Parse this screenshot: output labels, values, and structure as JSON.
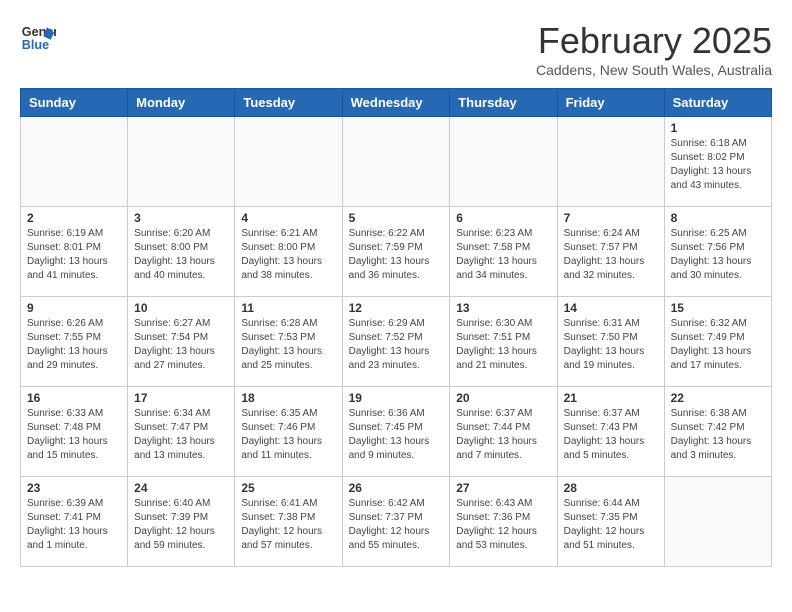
{
  "logo": {
    "line1": "General",
    "line2": "Blue"
  },
  "title": "February 2025",
  "location": "Caddens, New South Wales, Australia",
  "weekdays": [
    "Sunday",
    "Monday",
    "Tuesday",
    "Wednesday",
    "Thursday",
    "Friday",
    "Saturday"
  ],
  "weeks": [
    [
      {
        "day": "",
        "info": ""
      },
      {
        "day": "",
        "info": ""
      },
      {
        "day": "",
        "info": ""
      },
      {
        "day": "",
        "info": ""
      },
      {
        "day": "",
        "info": ""
      },
      {
        "day": "",
        "info": ""
      },
      {
        "day": "1",
        "info": "Sunrise: 6:18 AM\nSunset: 8:02 PM\nDaylight: 13 hours\nand 43 minutes."
      }
    ],
    [
      {
        "day": "2",
        "info": "Sunrise: 6:19 AM\nSunset: 8:01 PM\nDaylight: 13 hours\nand 41 minutes."
      },
      {
        "day": "3",
        "info": "Sunrise: 6:20 AM\nSunset: 8:00 PM\nDaylight: 13 hours\nand 40 minutes."
      },
      {
        "day": "4",
        "info": "Sunrise: 6:21 AM\nSunset: 8:00 PM\nDaylight: 13 hours\nand 38 minutes."
      },
      {
        "day": "5",
        "info": "Sunrise: 6:22 AM\nSunset: 7:59 PM\nDaylight: 13 hours\nand 36 minutes."
      },
      {
        "day": "6",
        "info": "Sunrise: 6:23 AM\nSunset: 7:58 PM\nDaylight: 13 hours\nand 34 minutes."
      },
      {
        "day": "7",
        "info": "Sunrise: 6:24 AM\nSunset: 7:57 PM\nDaylight: 13 hours\nand 32 minutes."
      },
      {
        "day": "8",
        "info": "Sunrise: 6:25 AM\nSunset: 7:56 PM\nDaylight: 13 hours\nand 30 minutes."
      }
    ],
    [
      {
        "day": "9",
        "info": "Sunrise: 6:26 AM\nSunset: 7:55 PM\nDaylight: 13 hours\nand 29 minutes."
      },
      {
        "day": "10",
        "info": "Sunrise: 6:27 AM\nSunset: 7:54 PM\nDaylight: 13 hours\nand 27 minutes."
      },
      {
        "day": "11",
        "info": "Sunrise: 6:28 AM\nSunset: 7:53 PM\nDaylight: 13 hours\nand 25 minutes."
      },
      {
        "day": "12",
        "info": "Sunrise: 6:29 AM\nSunset: 7:52 PM\nDaylight: 13 hours\nand 23 minutes."
      },
      {
        "day": "13",
        "info": "Sunrise: 6:30 AM\nSunset: 7:51 PM\nDaylight: 13 hours\nand 21 minutes."
      },
      {
        "day": "14",
        "info": "Sunrise: 6:31 AM\nSunset: 7:50 PM\nDaylight: 13 hours\nand 19 minutes."
      },
      {
        "day": "15",
        "info": "Sunrise: 6:32 AM\nSunset: 7:49 PM\nDaylight: 13 hours\nand 17 minutes."
      }
    ],
    [
      {
        "day": "16",
        "info": "Sunrise: 6:33 AM\nSunset: 7:48 PM\nDaylight: 13 hours\nand 15 minutes."
      },
      {
        "day": "17",
        "info": "Sunrise: 6:34 AM\nSunset: 7:47 PM\nDaylight: 13 hours\nand 13 minutes."
      },
      {
        "day": "18",
        "info": "Sunrise: 6:35 AM\nSunset: 7:46 PM\nDaylight: 13 hours\nand 11 minutes."
      },
      {
        "day": "19",
        "info": "Sunrise: 6:36 AM\nSunset: 7:45 PM\nDaylight: 13 hours\nand 9 minutes."
      },
      {
        "day": "20",
        "info": "Sunrise: 6:37 AM\nSunset: 7:44 PM\nDaylight: 13 hours\nand 7 minutes."
      },
      {
        "day": "21",
        "info": "Sunrise: 6:37 AM\nSunset: 7:43 PM\nDaylight: 13 hours\nand 5 minutes."
      },
      {
        "day": "22",
        "info": "Sunrise: 6:38 AM\nSunset: 7:42 PM\nDaylight: 13 hours\nand 3 minutes."
      }
    ],
    [
      {
        "day": "23",
        "info": "Sunrise: 6:39 AM\nSunset: 7:41 PM\nDaylight: 13 hours\nand 1 minute."
      },
      {
        "day": "24",
        "info": "Sunrise: 6:40 AM\nSunset: 7:39 PM\nDaylight: 12 hours\nand 59 minutes."
      },
      {
        "day": "25",
        "info": "Sunrise: 6:41 AM\nSunset: 7:38 PM\nDaylight: 12 hours\nand 57 minutes."
      },
      {
        "day": "26",
        "info": "Sunrise: 6:42 AM\nSunset: 7:37 PM\nDaylight: 12 hours\nand 55 minutes."
      },
      {
        "day": "27",
        "info": "Sunrise: 6:43 AM\nSunset: 7:36 PM\nDaylight: 12 hours\nand 53 minutes."
      },
      {
        "day": "28",
        "info": "Sunrise: 6:44 AM\nSunset: 7:35 PM\nDaylight: 12 hours\nand 51 minutes."
      },
      {
        "day": "",
        "info": ""
      }
    ]
  ]
}
